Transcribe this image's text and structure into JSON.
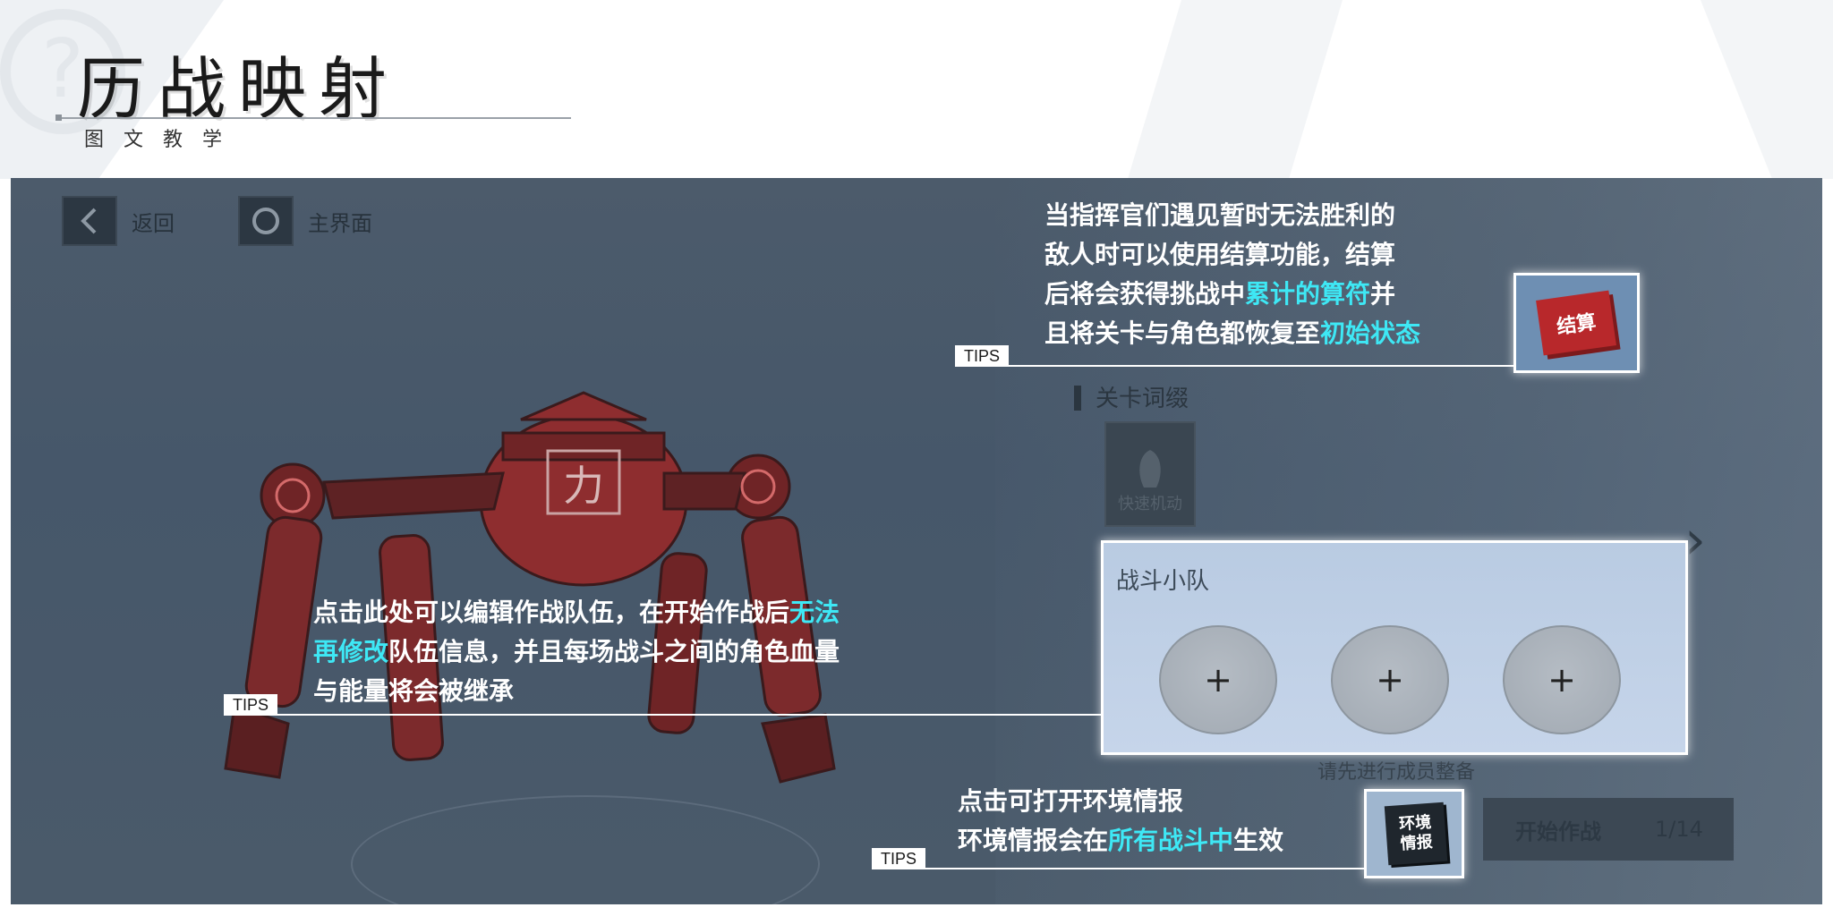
{
  "header": {
    "title": "历战映射",
    "subtitle": "图文教学"
  },
  "game_ui": {
    "back_label": "返回",
    "home_label": "主界面",
    "keyword_label": "关卡词缀",
    "quick_move_label": "快速机动",
    "robot_badge": "力",
    "team_title": "战斗小队",
    "slot_symbol": "+",
    "prep_hint": "请先进行成员整备",
    "start_label": "开始作战",
    "start_count": "1/14",
    "settle_label": "结算",
    "env_label_1": "环境",
    "env_label_2": "情报"
  },
  "tips": [
    {
      "tag": "TIPS",
      "lines": [
        [
          {
            "t": "当指挥官们遇见暂时无法胜利的"
          }
        ],
        [
          {
            "t": "敌人时可以使用结算功能，结算"
          }
        ],
        [
          {
            "t": "后将会获得挑战中"
          },
          {
            "t": "累计的算符",
            "hl": true
          },
          {
            "t": "并"
          }
        ],
        [
          {
            "t": "且将关卡与角色都恢复至"
          },
          {
            "t": "初始状态",
            "hl": true
          }
        ]
      ]
    },
    {
      "tag": "TIPS",
      "lines": [
        [
          {
            "t": "点击此处可以编辑作战队伍，在开始作战后"
          },
          {
            "t": "无法",
            "hl": true
          }
        ],
        [
          {
            "t": "再修改",
            "hl": true
          },
          {
            "t": "队伍信息，并且每场战斗之间的角色血量"
          }
        ],
        [
          {
            "t": "与能量将会被继承"
          }
        ]
      ]
    },
    {
      "tag": "TIPS",
      "lines": [
        [
          {
            "t": "点击可打开环境情报"
          }
        ],
        [
          {
            "t": "环境情报会在"
          },
          {
            "t": "所有战斗中",
            "hl": true
          },
          {
            "t": "生效"
          }
        ]
      ]
    }
  ],
  "colors": {
    "highlight": "#3ee8f5",
    "settle_red": "#b8282b",
    "panel_bg": "#4a5a6a"
  }
}
